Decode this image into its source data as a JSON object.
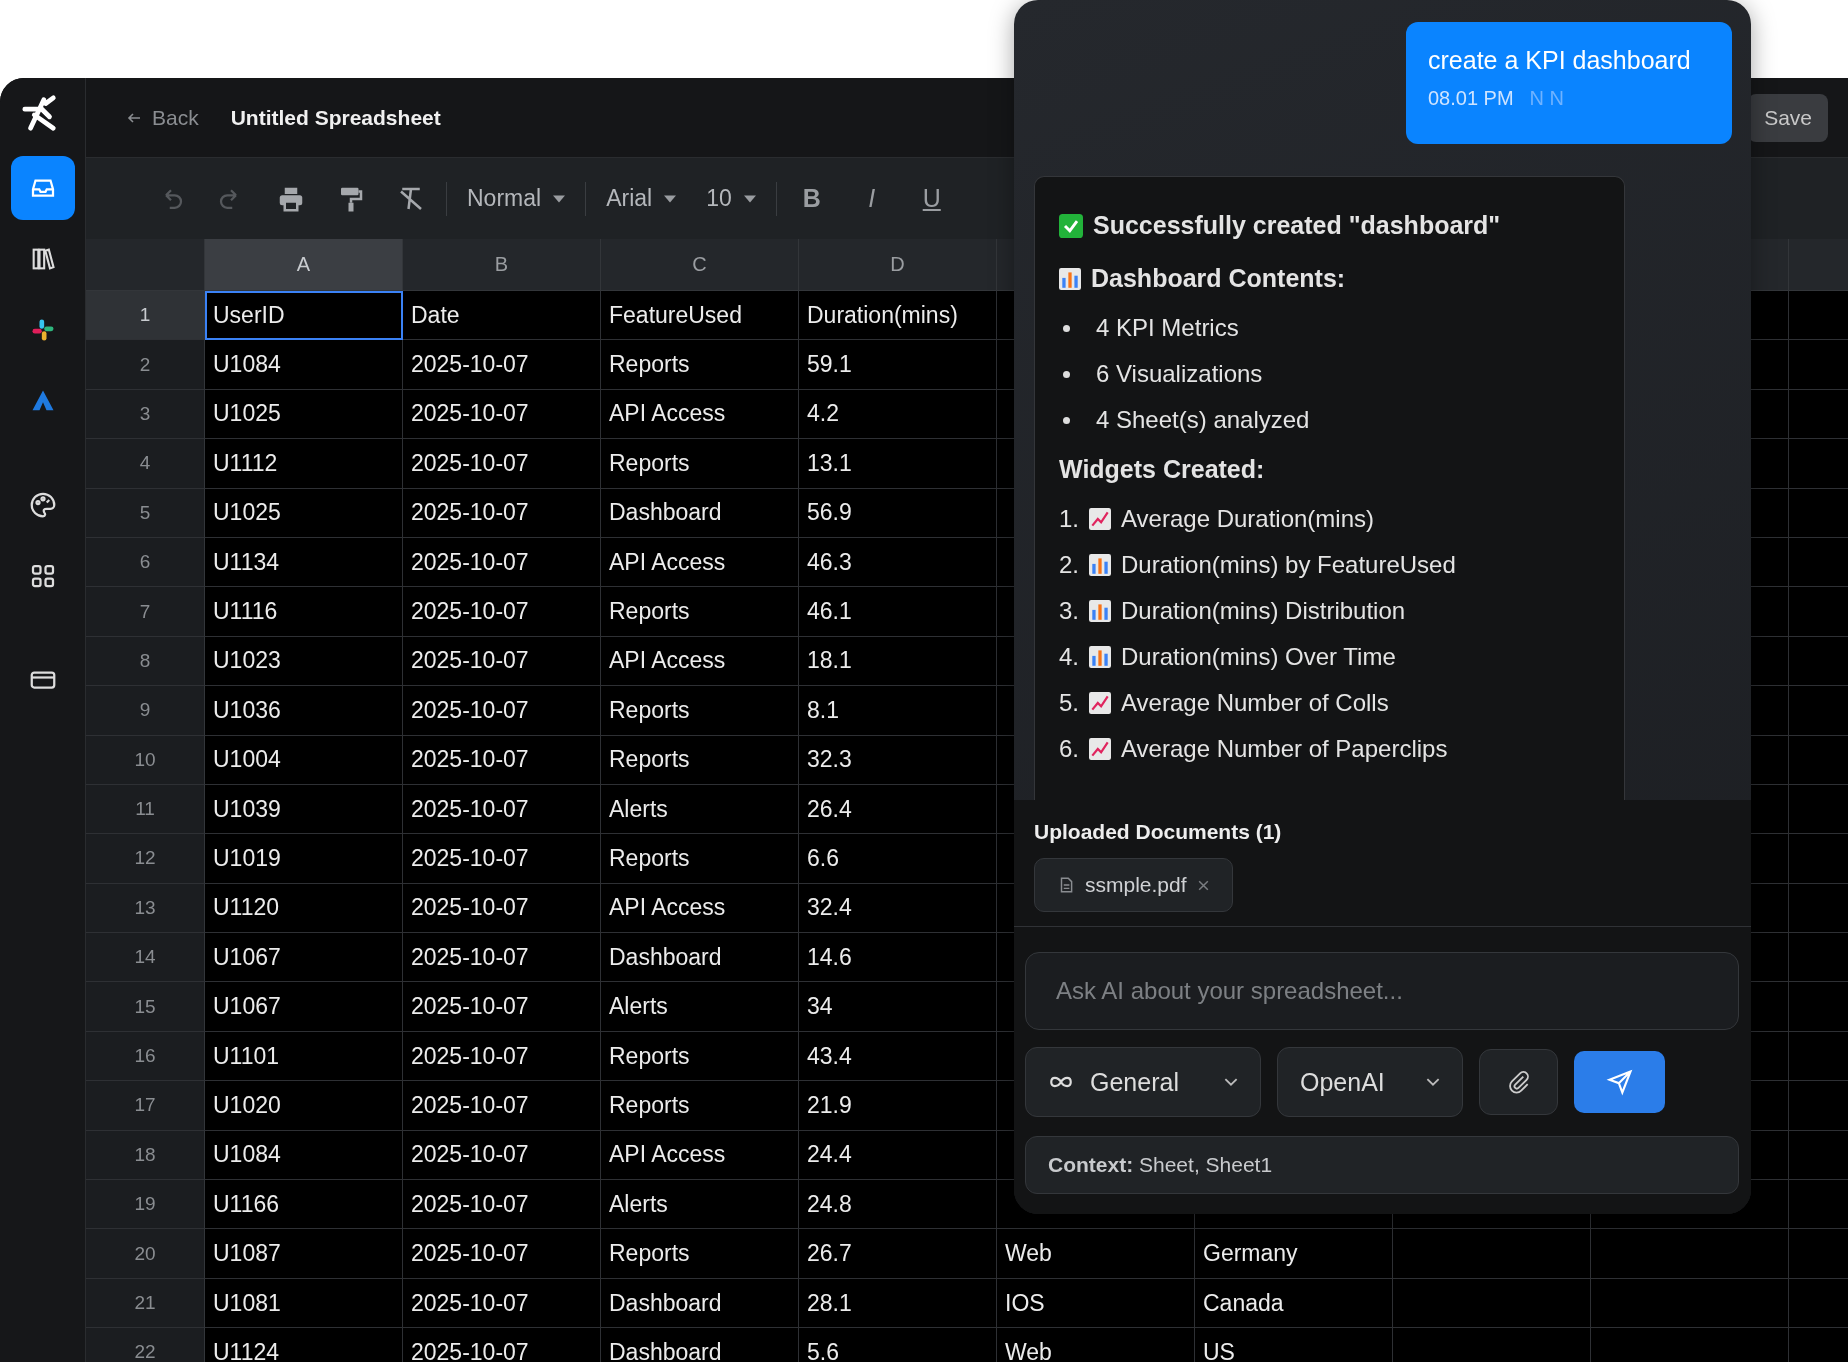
{
  "sidebar": {
    "groups": [
      [
        {
          "selected": true
        },
        {
          "selected": false
        },
        {
          "selected": false
        },
        {
          "selected": false
        }
      ],
      [
        {
          "selected": false
        },
        {
          "selected": false
        }
      ],
      [
        {
          "selected": false
        }
      ]
    ]
  },
  "header": {
    "back": "Back",
    "title": "Untitled Spreadsheet",
    "save": "Save"
  },
  "toolbar": {
    "undo_disabled": true,
    "redo_disabled": true,
    "style": "Normal",
    "font": "Arial",
    "size": "10",
    "bold": "B",
    "italic": "I",
    "underline": "U"
  },
  "sheet": {
    "columns": [
      {
        "label": "A",
        "selected": true
      },
      {
        "label": "B",
        "selected": false
      },
      {
        "label": "C",
        "selected": false
      },
      {
        "label": "D",
        "selected": false
      }
    ],
    "rows": [
      {
        "number": "1",
        "selected": true,
        "cells": [
          "UserID",
          "Date",
          "FeatureUsed",
          "Duration(mins)"
        ]
      },
      {
        "number": "2",
        "selected": false,
        "cells": [
          "U1084",
          "2025-10-07",
          "Reports",
          "59.1"
        ]
      },
      {
        "number": "3",
        "selected": false,
        "cells": [
          "U1025",
          "2025-10-07",
          "API Access",
          "4.2"
        ]
      },
      {
        "number": "4",
        "selected": false,
        "cells": [
          "U1112",
          "2025-10-07",
          "Reports",
          "13.1"
        ]
      },
      {
        "number": "5",
        "selected": false,
        "cells": [
          "U1025",
          "2025-10-07",
          "Dashboard",
          "56.9"
        ]
      },
      {
        "number": "6",
        "selected": false,
        "cells": [
          "U1134",
          "2025-10-07",
          "API Access",
          "46.3"
        ]
      },
      {
        "number": "7",
        "selected": false,
        "cells": [
          "U1116",
          "2025-10-07",
          "Reports",
          "46.1"
        ]
      },
      {
        "number": "8",
        "selected": false,
        "cells": [
          "U1023",
          "2025-10-07",
          "API Access",
          "18.1"
        ]
      },
      {
        "number": "9",
        "selected": false,
        "cells": [
          "U1036",
          "2025-10-07",
          "Reports",
          "8.1"
        ]
      },
      {
        "number": "10",
        "selected": false,
        "cells": [
          "U1004",
          "2025-10-07",
          "Reports",
          "32.3"
        ]
      },
      {
        "number": "11",
        "selected": false,
        "cells": [
          "U1039",
          "2025-10-07",
          "Alerts",
          "26.4"
        ]
      },
      {
        "number": "12",
        "selected": false,
        "cells": [
          "U1019",
          "2025-10-07",
          "Reports",
          "6.6"
        ]
      },
      {
        "number": "13",
        "selected": false,
        "cells": [
          "U1120",
          "2025-10-07",
          "API Access",
          "32.4"
        ]
      },
      {
        "number": "14",
        "selected": false,
        "cells": [
          "U1067",
          "2025-10-07",
          "Dashboard",
          "14.6"
        ]
      },
      {
        "number": "15",
        "selected": false,
        "cells": [
          "U1067",
          "2025-10-07",
          "Alerts",
          "34"
        ]
      },
      {
        "number": "16",
        "selected": false,
        "cells": [
          "U1101",
          "2025-10-07",
          "Reports",
          "43.4"
        ]
      },
      {
        "number": "17",
        "selected": false,
        "cells": [
          "U1020",
          "2025-10-07",
          "Reports",
          "21.9"
        ]
      },
      {
        "number": "18",
        "selected": false,
        "cells": [
          "U1084",
          "2025-10-07",
          "API Access",
          "24.4"
        ]
      },
      {
        "number": "19",
        "selected": false,
        "cells": [
          "U1166",
          "2025-10-07",
          "Alerts",
          "24.8"
        ]
      },
      {
        "number": "20",
        "selected": false,
        "cells": [
          "U1087",
          "2025-10-07",
          "Reports",
          "26.7",
          "Web",
          "Germany"
        ]
      },
      {
        "number": "21",
        "selected": false,
        "cells": [
          "U1081",
          "2025-10-07",
          "Dashboard",
          "28.1",
          "IOS",
          "Canada"
        ]
      },
      {
        "number": "22",
        "selected": false,
        "cells": [
          "U1124",
          "2025-10-07",
          "Dashboard",
          "5.6",
          "Web",
          "US"
        ]
      }
    ]
  },
  "chat": {
    "user_message": {
      "text": "create a KPI dashboard",
      "time": "08.01 PM",
      "status": "N N"
    },
    "reply": {
      "title": "Successfully created \"dashboard\"",
      "contents_heading": "Dashboard Contents:",
      "contents": [
        "4 KPI Metrics",
        "6 Visualizations",
        "4 Sheet(s) analyzed"
      ],
      "widgets_heading": "Widgets Created:",
      "widgets": [
        {
          "number": "1.",
          "kind": "line",
          "label": "Average Duration(mins)"
        },
        {
          "number": "2.",
          "kind": "bar",
          "label": "Duration(mins) by FeatureUsed"
        },
        {
          "number": "3.",
          "kind": "bar",
          "label": "Duration(mins) Distribution"
        },
        {
          "number": "4.",
          "kind": "bar",
          "label": "Duration(mins) Over Time"
        },
        {
          "number": "5.",
          "kind": "line",
          "label": "Average Number of Colls"
        },
        {
          "number": "6.",
          "kind": "line",
          "label": "Average Number of Paperclips"
        }
      ]
    },
    "uploads": {
      "heading": "Uploaded Documents (1)",
      "files": [
        "ssmple.pdf"
      ]
    },
    "input": {
      "placeholder": "Ask AI about your spreadsheet..."
    },
    "mode": "General",
    "model": "OpenAI",
    "context": "**Context:** Sheet, Sheet1"
  }
}
